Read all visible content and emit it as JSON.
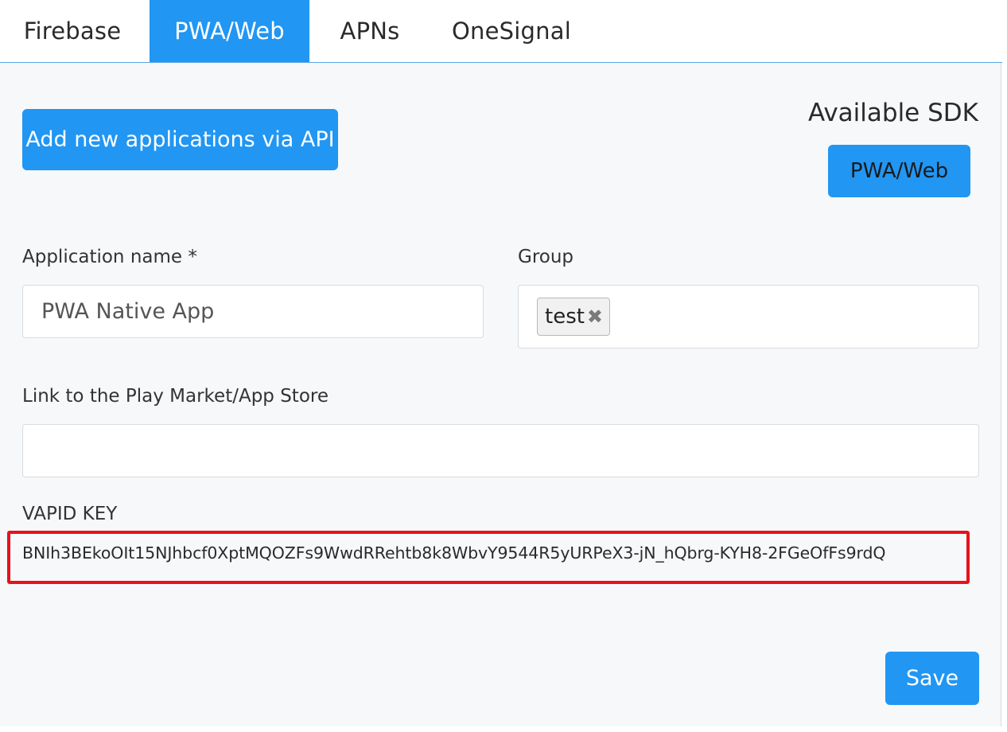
{
  "tabs": [
    {
      "label": "Firebase",
      "active": false
    },
    {
      "label": "PWA/Web",
      "active": true
    },
    {
      "label": "APNs",
      "active": false
    },
    {
      "label": "OneSignal",
      "active": false
    }
  ],
  "actions": {
    "add_via_api_label": "Add new applications via API",
    "save_label": "Save"
  },
  "sdk": {
    "title": "Available SDK",
    "button_label": "PWA/Web"
  },
  "form": {
    "app_name_label": "Application name *",
    "app_name_value": "PWA Native App",
    "group_label": "Group",
    "group_tags": [
      "test"
    ],
    "store_link_label": "Link to the Play Market/App Store",
    "store_link_value": "",
    "vapid_label": "VAPID KEY",
    "vapid_value": "BNIh3BEkoOIt15NJhbcf0XptMQOZFs9WwdRRehtb8k8WbvY9544R5yURPeX3-jN_hQbrg-KYH8-2FGeOfFs9rdQ"
  },
  "colors": {
    "accent": "#2196f3",
    "highlight_border": "#e8111b",
    "panel_bg": "#f7f8fa"
  }
}
